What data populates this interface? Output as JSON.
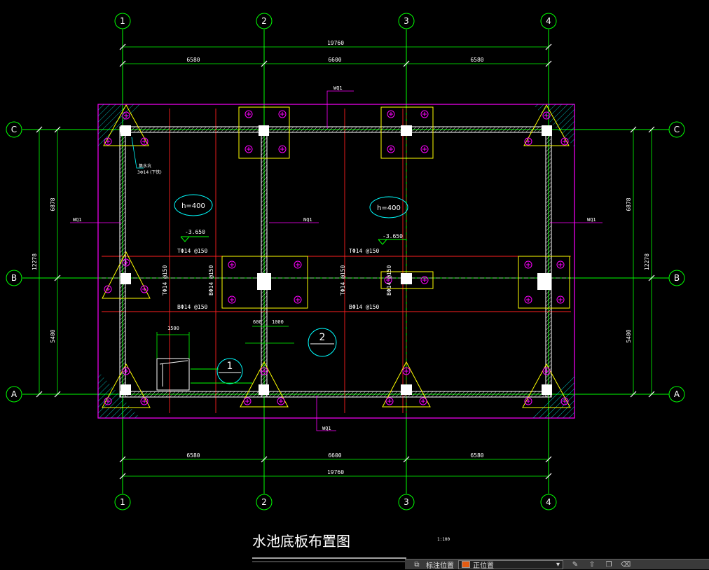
{
  "axes": {
    "columns": [
      "1",
      "2",
      "3",
      "4"
    ],
    "rows": [
      "C",
      "B",
      "A"
    ]
  },
  "dims": {
    "top_total": "19760",
    "top_seg1": "6580",
    "top_seg2": "6600",
    "top_seg3": "6580",
    "bot_total": "19760",
    "bot_seg1": "6580",
    "bot_seg2": "6600",
    "bot_seg3": "6580",
    "left_total": "12278",
    "left_upper": "6878",
    "left_lower": "5400",
    "right_total": "12278",
    "right_upper": "6878",
    "right_lower": "5400",
    "small_1500": "1500",
    "small_600": "600",
    "small_1000": "1000"
  },
  "labels": {
    "wq1_top": "WQ1",
    "wq1_left": "WQ1",
    "wq1_right": "WQ1",
    "wq1_bottom": "WQ1",
    "nq1": "NQ1",
    "h_left": "h=400",
    "h_right": "h=400",
    "elev_left": "-3.650",
    "elev_right": "-3.650",
    "top_rebar_left": "TΦ14 @150",
    "top_rebar_right": "TΦ14 @150",
    "bot_rebar_left": "BΦ14 @150",
    "bot_rebar_right": "BΦ14 @150",
    "vert_rebar_1": "TΦ14 @150",
    "vert_rebar_2": "BΦ14 @150",
    "vert_rebar_3": "TΦ14 @150",
    "vert_rebar_4": "BΦ14 @150",
    "sump_note_1": "集水坑",
    "sump_note_2": "3Φ14 (下铁)",
    "detail_1": "1",
    "detail_2": "2"
  },
  "title": {
    "main": "水池底板布置图",
    "scale": "1:100"
  },
  "statusbar": {
    "label": "标注位置",
    "layer": "正位置"
  },
  "colors": {
    "axis_green": "#00ff00",
    "slab_magenta": "#ff00ff",
    "wall_white": "#ffffff",
    "pile_yellow": "#ffff00",
    "rebar_red": "#ff2020",
    "note_cyan": "#00ffff"
  }
}
